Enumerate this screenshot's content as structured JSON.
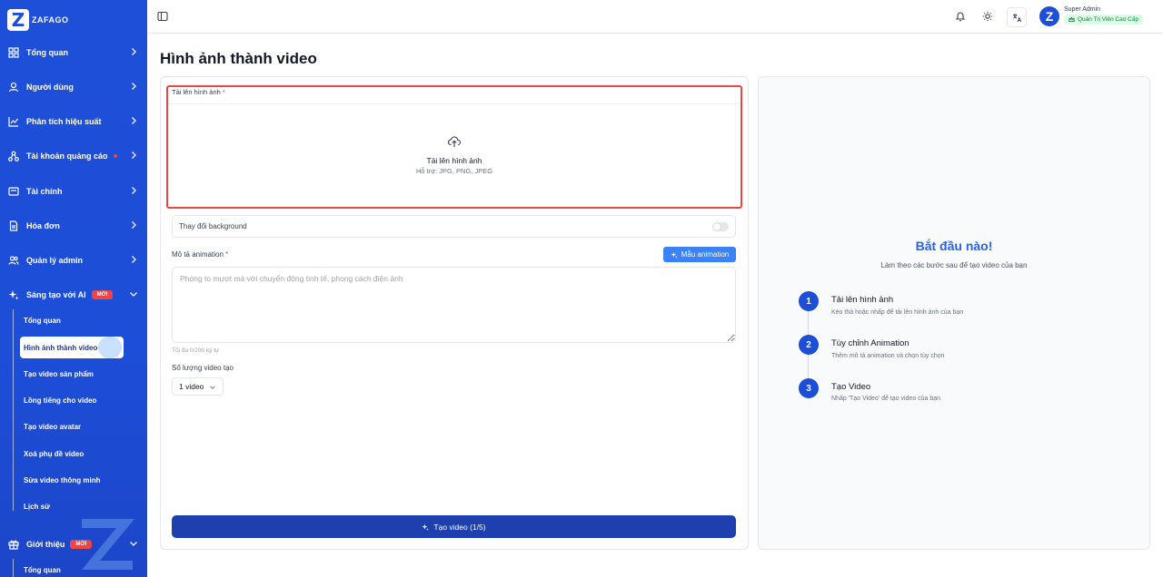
{
  "brand": {
    "name": "ZAFAGO",
    "mark": "Z"
  },
  "sidebar": {
    "items": [
      {
        "label": "Tổng quan"
      },
      {
        "label": "Người dùng"
      },
      {
        "label": "Phân tích hiệu suất"
      },
      {
        "label": "Tài khoản quảng cáo"
      },
      {
        "label": "Tài chính"
      },
      {
        "label": "Hóa đơn"
      },
      {
        "label": "Quản lý admin"
      },
      {
        "label": "Sáng tạo với AI",
        "badge": "MỚI"
      }
    ],
    "sub_items": [
      {
        "label": "Tổng quan"
      },
      {
        "label": "Hình ảnh thành video"
      },
      {
        "label": "Tạo video sản phẩm"
      },
      {
        "label": "Lồng tiếng cho video"
      },
      {
        "label": "Tạo video avatar"
      },
      {
        "label": "Xoá phụ đề video"
      },
      {
        "label": "Sửa video thông minh"
      },
      {
        "label": "Lịch sử"
      }
    ],
    "intro": {
      "label": "Giới thiệu",
      "badge": "MỚI"
    },
    "intro_sub": {
      "label": "Tổng quan"
    }
  },
  "header": {
    "avatar_letter": "Z",
    "user_name": "Super Admin",
    "role": "Quản Trị Viên Cao Cấp"
  },
  "main": {
    "title": "Hình ảnh thành video",
    "upload": {
      "label": "Tải lên hình ảnh",
      "required": "*",
      "title": "Tải lên hình ảnh",
      "hint": "Hỗ trợ: JPG, PNG, JPEG"
    },
    "background": {
      "label": "Thay đổi background",
      "enabled": false
    },
    "animation": {
      "label": "Mô tả animation",
      "required": "*",
      "template_button": "Mẫu animation",
      "placeholder": "Phóng to mượt mà với chuyển động tinh tế, phong cách điện ảnh",
      "value": "",
      "char_count": "Tối đa 0/200 ký tự"
    },
    "quantity": {
      "label": "Số lượng video tạo",
      "selected": "1 video"
    },
    "create_button": "Tạo video (1/5)"
  },
  "guide": {
    "title": "Bắt đầu nào!",
    "subtitle": "Làm theo các bước sau để tạo video của bạn",
    "steps": [
      {
        "num": "1",
        "title": "Tải lên hình ảnh",
        "desc": "Kéo thả hoặc nhấp để tải lên hình ảnh của bạn"
      },
      {
        "num": "2",
        "title": "Tùy chỉnh Animation",
        "desc": "Thêm mô tả animation và chọn tùy chọn"
      },
      {
        "num": "3",
        "title": "Tạo Video",
        "desc": "Nhấp 'Tạo Video' để tạo video của bạn"
      }
    ]
  },
  "colors": {
    "primary": "#1d4ed8",
    "accent": "#3b82f6",
    "highlight_border": "#ef4444",
    "badge_new": "#ef4444",
    "role_badge": "#dcfce7"
  },
  "icons": [
    "sidebar-toggle-icon",
    "bell-icon",
    "sun-icon",
    "translate-icon",
    "upload-cloud-icon",
    "sparkle-icon",
    "chevron-right-icon",
    "chevron-down-icon"
  ]
}
